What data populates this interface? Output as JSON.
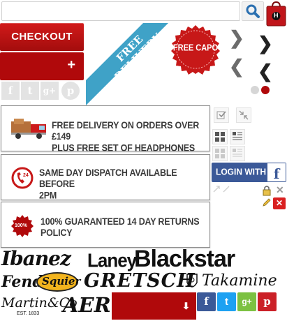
{
  "search": {
    "placeholder": "",
    "value": ""
  },
  "cart": {
    "badge": "H"
  },
  "checkout": {
    "label": "CHECKOUT"
  },
  "menu": {
    "label": "+"
  },
  "social_top": [
    "f",
    "t",
    "g+",
    "p"
  ],
  "promo": {
    "ribbon_line1": "FREE",
    "ribbon_line2": "DELIVERY",
    "capo": "FREE CAPO"
  },
  "panels": [
    {
      "line1": "FREE DELIVERY ON ORDERS OVER £149",
      "line2": "PLUS FREE SET OF HEADPHONES"
    },
    {
      "line1": "SAME DAY DISPATCH AVAILABLE BEFORE",
      "line2": "2PM"
    },
    {
      "line1": "100% GUARANTEED 14 DAY RETURNS",
      "line2": "POLICY",
      "badge": "100%"
    }
  ],
  "login": {
    "label": "LOGIN WITH",
    "fb": "f"
  },
  "brands": [
    "Ibanez",
    "Laney",
    "Blackstar",
    "Fender",
    "Squier",
    "GRETSCH",
    "Takamine",
    "Martin&Co",
    "EST. 1833",
    "AER"
  ],
  "colors": {
    "brand_red": "#b0090b",
    "facebook": "#3b5998",
    "twitter": "#1da1f2",
    "google": "#7cc142",
    "pinterest": "#cb2027"
  }
}
